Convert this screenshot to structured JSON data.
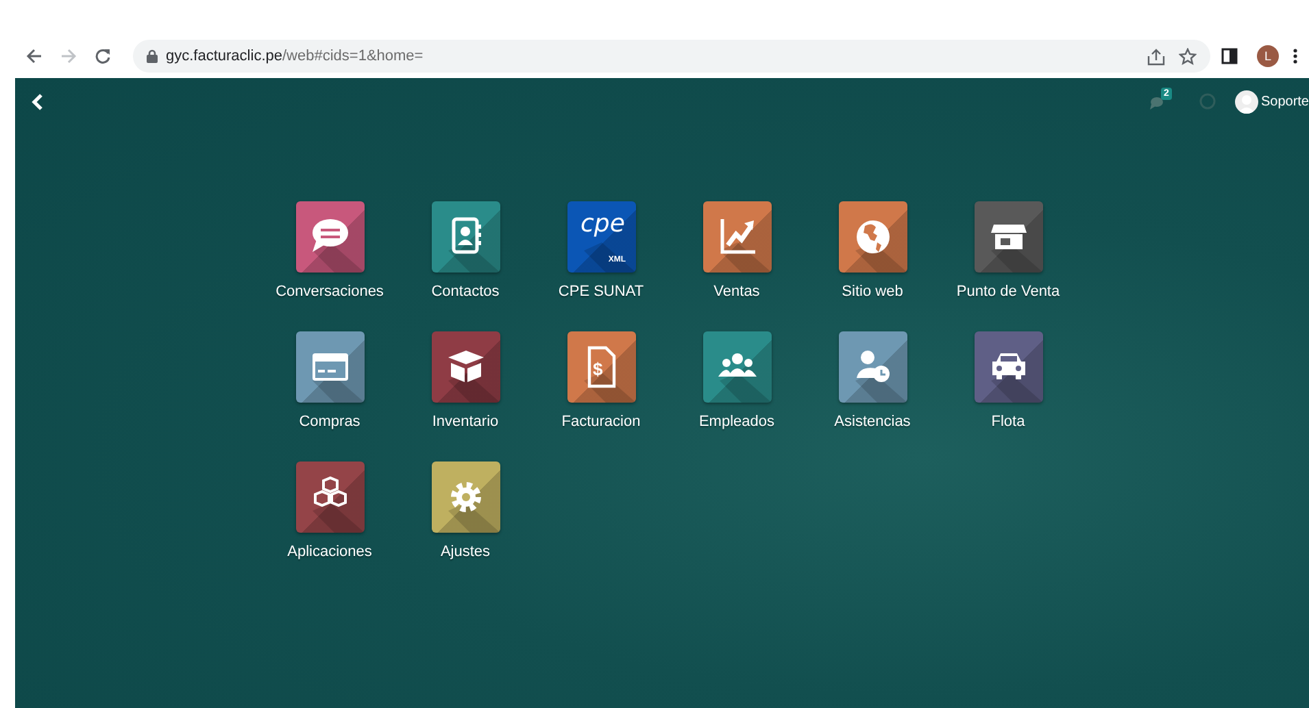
{
  "browser": {
    "url_host": "gyc.facturaclic.pe",
    "url_path": "/web#cids=1&home=",
    "forward_disabled": true,
    "profile_initial": "L"
  },
  "navbar": {
    "messages_count": "2",
    "user": "Soporte"
  },
  "apps": [
    {
      "label": "Conversaciones",
      "kind": "chat",
      "color": "#c8587c"
    },
    {
      "label": "Contactos",
      "kind": "contacts",
      "color": "#2a8c8a"
    },
    {
      "label": "CPE SUNAT",
      "kind": "logo",
      "color": "#0b56b5",
      "logo_text": "cpe",
      "logo_sub": "XML"
    },
    {
      "label": "Ventas",
      "kind": "chart",
      "color": "#d0784a"
    },
    {
      "label": "Sitio web",
      "kind": "globe",
      "color": "#d0784a"
    },
    {
      "label": "Punto de Venta",
      "kind": "store",
      "color": "#595959"
    },
    {
      "label": "Compras",
      "kind": "card",
      "color": "#6e98b2"
    },
    {
      "label": "Inventario",
      "kind": "box",
      "color": "#8f3c45"
    },
    {
      "label": "Facturacion",
      "kind": "invoice",
      "color": "#d0784a",
      "glyph": "$"
    },
    {
      "label": "Empleados",
      "kind": "people",
      "color": "#2a8c8a"
    },
    {
      "label": "Asistencias",
      "kind": "attendance",
      "color": "#6e98b2"
    },
    {
      "label": "Flota",
      "kind": "car",
      "color": "#5f5f86"
    },
    {
      "label": "Aplicaciones",
      "kind": "cubes",
      "color": "#944448"
    },
    {
      "label": "Ajustes",
      "kind": "gear",
      "color": "#bfb060"
    }
  ]
}
